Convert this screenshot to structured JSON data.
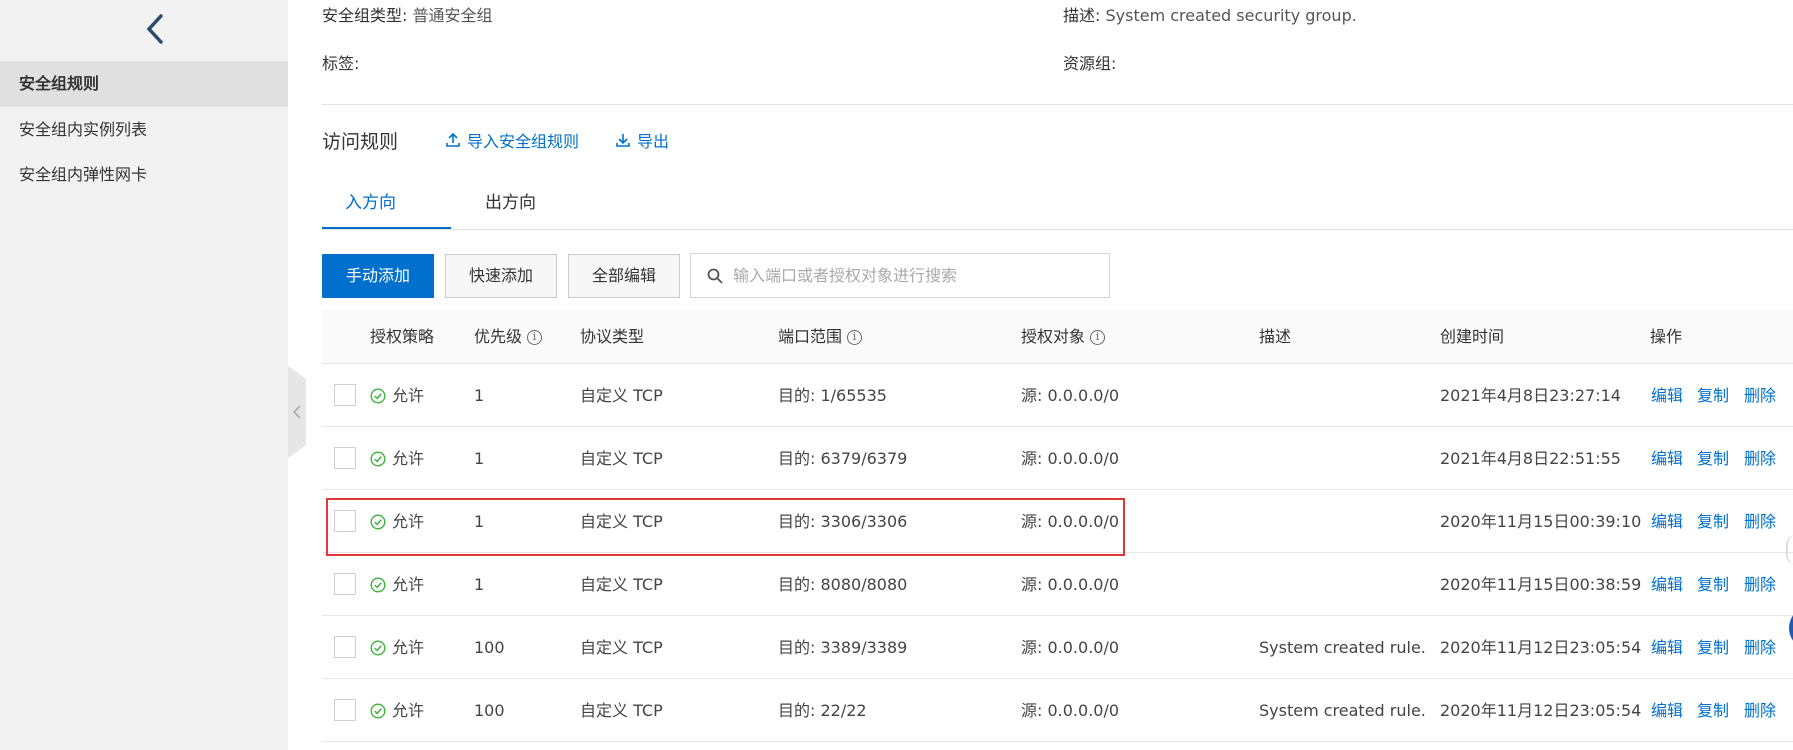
{
  "sidebar": {
    "items": [
      {
        "label": "安全组规则",
        "active": true
      },
      {
        "label": "安全组内实例列表",
        "active": false
      },
      {
        "label": "安全组内弹性网卡",
        "active": false
      }
    ]
  },
  "info": {
    "type_label": "安全组类型:",
    "type_value": "普通安全组",
    "desc_label": "描述:",
    "desc_value": "System created security group.",
    "tags_label": "标签:",
    "resource_group_label": "资源组:"
  },
  "rules": {
    "title": "访问规则",
    "import_label": "导入安全组规则",
    "export_label": "导出",
    "tabs": [
      "入方向",
      "出方向"
    ],
    "toolbar": {
      "manual_add": "手动添加",
      "quick_add": "快速添加",
      "edit_all": "全部编辑",
      "search_placeholder": "输入端口或者授权对象进行搜索"
    },
    "columns": [
      "授权策略",
      "优先级",
      "协议类型",
      "端口范围",
      "授权对象",
      "描述",
      "创建时间",
      "操作"
    ],
    "rows": [
      {
        "policy": "允许",
        "priority": "1",
        "protocol": "自定义 TCP",
        "port": "目的: 1/65535",
        "source": "源: 0.0.0.0/0",
        "desc": "",
        "created": "2021年4月8日23:27:14"
      },
      {
        "policy": "允许",
        "priority": "1",
        "protocol": "自定义 TCP",
        "port": "目的: 6379/6379",
        "source": "源: 0.0.0.0/0",
        "desc": "",
        "created": "2021年4月8日22:51:55"
      },
      {
        "policy": "允许",
        "priority": "1",
        "protocol": "自定义 TCP",
        "port": "目的: 3306/3306",
        "source": "源: 0.0.0.0/0",
        "desc": "",
        "created": "2020年11月15日00:39:10"
      },
      {
        "policy": "允许",
        "priority": "1",
        "protocol": "自定义 TCP",
        "port": "目的: 8080/8080",
        "source": "源: 0.0.0.0/0",
        "desc": "",
        "created": "2020年11月15日00:38:59"
      },
      {
        "policy": "允许",
        "priority": "100",
        "protocol": "自定义 TCP",
        "port": "目的: 3389/3389",
        "source": "源: 0.0.0.0/0",
        "desc": "System created rule.",
        "created": "2020年11月12日23:05:54"
      },
      {
        "policy": "允许",
        "priority": "100",
        "protocol": "自定义 TCP",
        "port": "目的: 22/22",
        "source": "源: 0.0.0.0/0",
        "desc": "System created rule.",
        "created": "2020年11月12日23:05:54"
      }
    ],
    "actions": {
      "edit": "编辑",
      "copy": "复制",
      "delete": "删除"
    }
  },
  "colors": {
    "accent": "#0070cc",
    "allow_green": "#3db33d",
    "highlight_red": "#e0383a"
  }
}
